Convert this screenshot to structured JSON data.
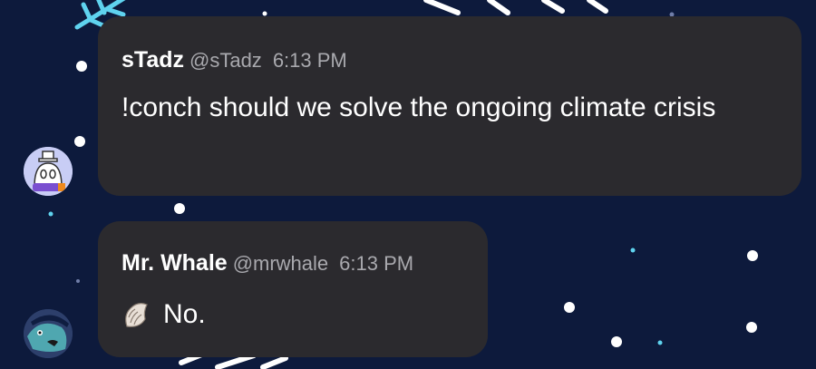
{
  "messages": [
    {
      "username": "sTadz",
      "handle": "@sTadz",
      "time": "6:13 PM",
      "text": "!conch should we solve the ongoing climate crisis"
    },
    {
      "username": "Mr. Whale",
      "handle": "@mrwhale",
      "time": "6:13 PM",
      "text": "No.",
      "icon": "conch-shell-icon"
    }
  ],
  "colors": {
    "background": "#0d1a3c",
    "bubble": "#2b2a2e",
    "meta_text": "#a9a9ae"
  }
}
